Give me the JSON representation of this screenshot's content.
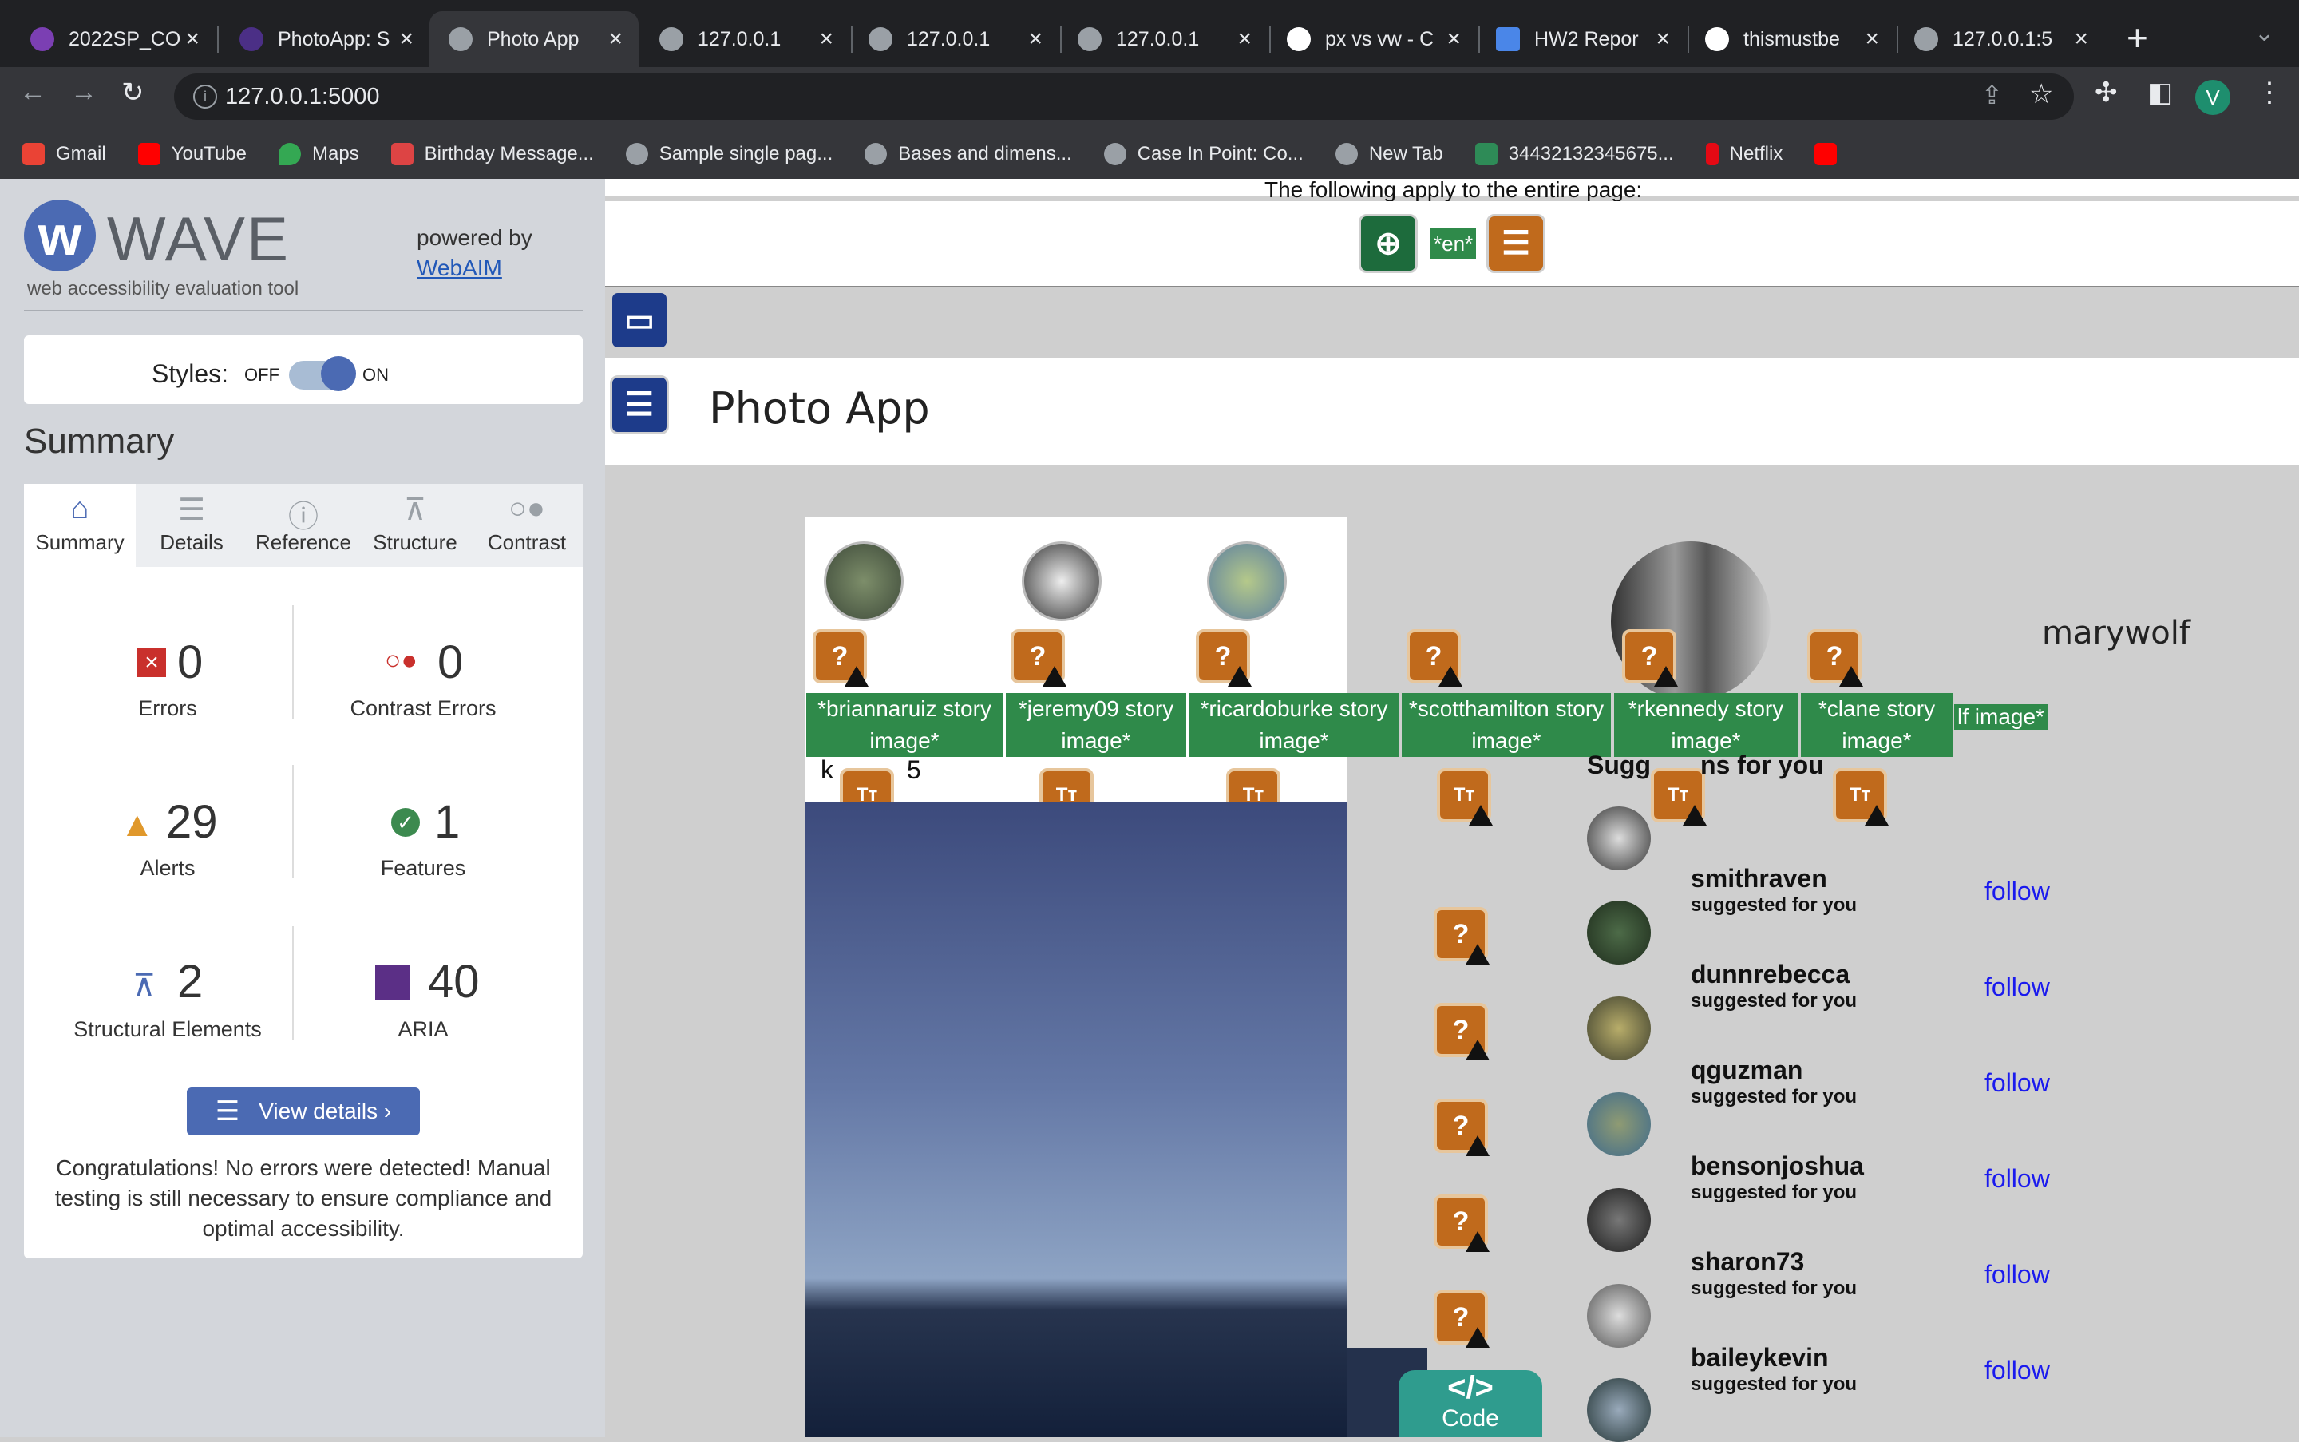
{
  "browser": {
    "tabs": [
      {
        "title": "2022SP_CO",
        "favicon_color": "#7b3fb3"
      },
      {
        "title": "PhotoApp: S",
        "favicon_color": "#4b2f86"
      },
      {
        "title": "Photo App",
        "favicon_color": "#9aa0a6"
      },
      {
        "title": "127.0.0.1",
        "favicon_color": "#9aa0a6"
      },
      {
        "title": "127.0.0.1",
        "favicon_color": "#9aa0a6"
      },
      {
        "title": "127.0.0.1",
        "favicon_color": "#9aa0a6"
      },
      {
        "title": "px vs vw - C",
        "favicon_color": "#ffffff"
      },
      {
        "title": "HW2 Repor",
        "favicon_color": "#4a86e8"
      },
      {
        "title": "thismustbe",
        "favicon_color": "#ffffff"
      },
      {
        "title": "127.0.0.1:5",
        "favicon_color": "#9aa0a6"
      }
    ],
    "url": "127.0.0.1:5000",
    "profile_initial": "V",
    "bookmarks": [
      {
        "label": "Gmail",
        "color": "#ea4335"
      },
      {
        "label": "YouTube",
        "color": "#ff0000"
      },
      {
        "label": "Maps",
        "color": "#34a853"
      },
      {
        "label": "Birthday Message...",
        "color": "#d44"
      },
      {
        "label": "Sample single pag...",
        "color": "#9aa0a6"
      },
      {
        "label": "Bases and dimens...",
        "color": "#9aa0a6"
      },
      {
        "label": "Case In Point: Co...",
        "color": "#9aa0a6"
      },
      {
        "label": "New Tab",
        "color": "#9aa0a6"
      },
      {
        "label": "34432132345675...",
        "color": "#2e8b57"
      },
      {
        "label": "Netflix",
        "color": "#e50914"
      },
      {
        "label": "",
        "color": "#ff0000"
      }
    ]
  },
  "wave": {
    "logo_text": "WAVE",
    "subtitle": "web accessibility evaluation tool",
    "powered_by": "powered by",
    "webaim_link": "WebAIM",
    "styles_label": "Styles:",
    "off_label": "OFF",
    "on_label": "ON",
    "summary_heading": "Summary",
    "tabs": [
      "Summary",
      "Details",
      "Reference",
      "Structure",
      "Contrast"
    ],
    "stats": {
      "errors": {
        "value": "0",
        "label": "Errors"
      },
      "contrast_errors": {
        "value": "0",
        "label": "Contrast Errors"
      },
      "alerts": {
        "value": "29",
        "label": "Alerts"
      },
      "features": {
        "value": "1",
        "label": "Features"
      },
      "structural": {
        "value": "2",
        "label": "Structural Elements"
      },
      "aria": {
        "value": "40",
        "label": "ARIA"
      }
    },
    "view_details": "View details ›",
    "congrats": "Congratulations! No errors were detected! Manual testing is still necessary to ensure compliance and optimal accessibility."
  },
  "page": {
    "apply_text": "The following apply to the entire page:",
    "lang_tag": "*en*",
    "app_title": "Photo App",
    "story_alts": [
      "*briannaruiz story image*",
      "*jeremy09 story image*",
      "*ricardoburke story image*",
      "*scotthamilton story image*",
      "*rkennedy story image*",
      "*clane story image*"
    ],
    "partial_alt": "lf image*",
    "post_user_fragment": "k",
    "post_user_fragment2": "5",
    "right_username": "marywolf",
    "suggestions_heading": "Sugg",
    "suggestions_heading_end": "ns for you",
    "suggestions": [
      {
        "name": "smithraven",
        "sub": "suggested for you",
        "action": "follow"
      },
      {
        "name": "dunnrebecca",
        "sub": "suggested for you",
        "action": "follow"
      },
      {
        "name": "qguzman",
        "sub": "suggested for you",
        "action": "follow"
      },
      {
        "name": "bensonjoshua",
        "sub": "suggested for you",
        "action": "follow"
      },
      {
        "name": "sharon73",
        "sub": "suggested for you",
        "action": "follow"
      },
      {
        "name": "baileykevin",
        "sub": "suggested for you",
        "action": "follow"
      }
    ],
    "code_button": "Code"
  }
}
